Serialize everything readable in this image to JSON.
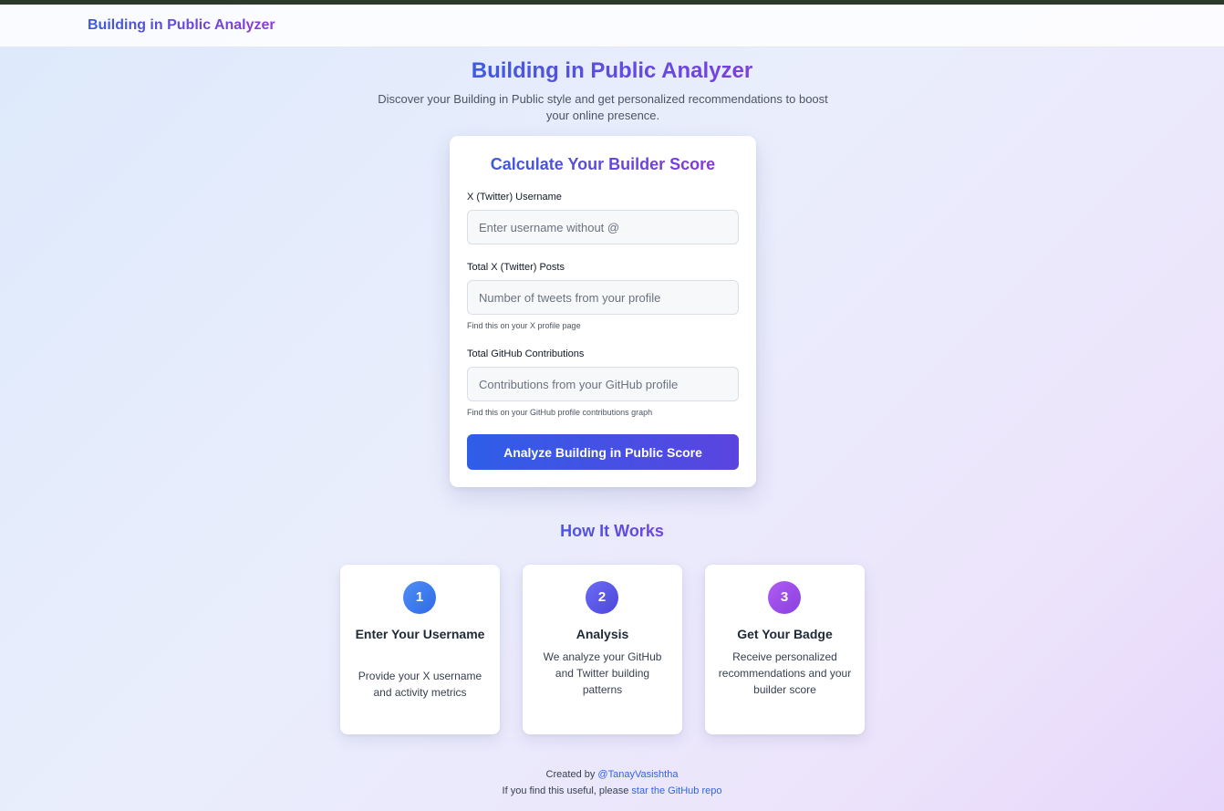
{
  "nav": {
    "brand": "Building in Public Analyzer"
  },
  "hero": {
    "title": "Building in Public Analyzer",
    "subtitle": "Discover your Building in Public style and get personalized recommendations to boost your online presence."
  },
  "form": {
    "title": "Calculate Your Builder Score",
    "username_label": "X (Twitter) Username",
    "username_placeholder": "Enter username without @",
    "posts_label": "Total X (Twitter) Posts",
    "posts_placeholder": "Number of tweets from your profile",
    "posts_hint": "Find this on your X profile page",
    "contrib_label": "Total GitHub Contributions",
    "contrib_placeholder": "Contributions from your GitHub profile",
    "contrib_hint": "Find this on your GitHub profile contributions graph",
    "submit_label": "Analyze Building in Public Score"
  },
  "how": {
    "title": "How It Works",
    "steps": [
      {
        "num": "1",
        "title": "Enter Your Username",
        "desc": "Provide your X username and activity metrics",
        "color": "#3b82f6"
      },
      {
        "num": "2",
        "title": "Analysis",
        "desc": "We analyze your GitHub and Twitter building patterns",
        "color": "#6366f1"
      },
      {
        "num": "3",
        "title": "Get Your Badge",
        "desc": "Receive personalized recommendations and your builder score",
        "color": "#a855f7"
      }
    ]
  },
  "footer": {
    "created_prefix": "Created by",
    "author_link": "@TanayVasishtha",
    "useful_prefix": "If you find this useful, please",
    "repo_link": "star the GitHub repo"
  },
  "colors": {
    "accent_blue": "#2e5ee8",
    "accent_purple": "#8438d8"
  }
}
